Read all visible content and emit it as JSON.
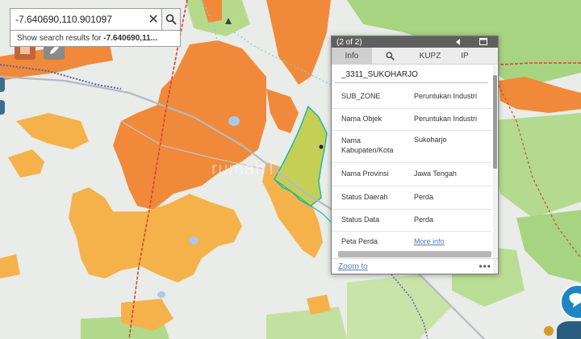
{
  "search": {
    "value": "-7.640690,110.901097",
    "suggestion_prefix": "Show search results for ",
    "suggestion_query": "-7.640690,11..."
  },
  "popup": {
    "counter": "(2 of 2)",
    "tabs": [
      {
        "label": "Info",
        "active": true
      },
      {
        "label": "",
        "icon": "search-icon"
      },
      {
        "label": "KUPZ"
      },
      {
        "label": "IP"
      }
    ],
    "feature_title": "_3311_SUKOHARJO",
    "attributes": [
      {
        "key": "SUB_ZONE",
        "value": "Peruntukan Industri"
      },
      {
        "key": "Nama Objek",
        "value": "Peruntukan Industri"
      },
      {
        "key": "Nama Kabupaten/Kota",
        "value": "Sukoharjo"
      },
      {
        "key": "Nama Provinsi",
        "value": "Jawa Tengah"
      },
      {
        "key": "Status Daerah",
        "value": "Perda"
      },
      {
        "key": "Status Data",
        "value": "Perda"
      },
      {
        "key": "Peta Perda",
        "value": "More info",
        "link": true
      }
    ],
    "zoom_label": "Zoom to",
    "more_label": "•••"
  },
  "watermark": "rumahT",
  "colors": {
    "industrial_zone": "#f08a3a",
    "settlement_zone": "#f5b24a",
    "selected_zone": "#c5cf56",
    "selected_outline": "#1fb8a6",
    "farmland": "#a7d480",
    "base": "#e9ece8",
    "railway": "#d0453a",
    "boundary": "#5a5fb0",
    "accent_link": "#5579b8"
  }
}
